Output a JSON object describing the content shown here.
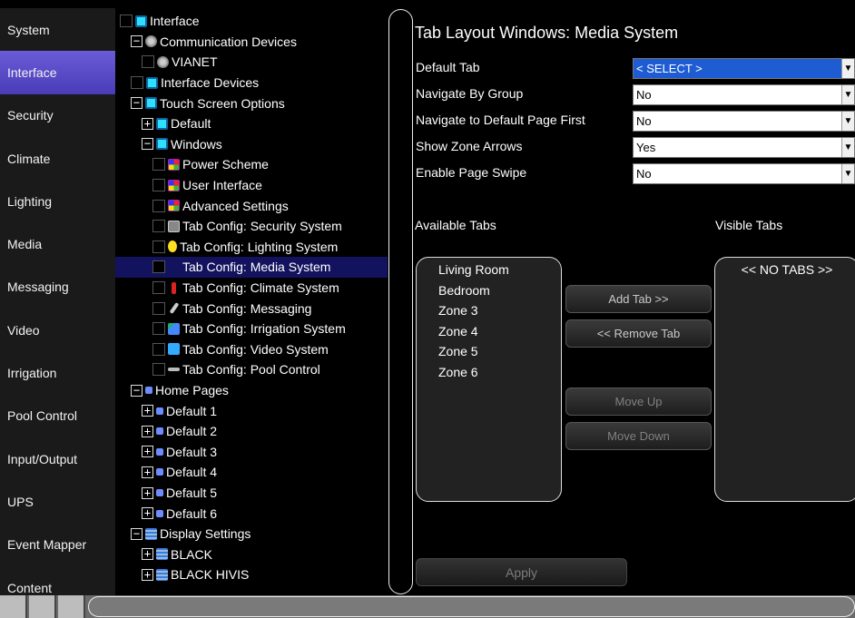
{
  "nav": {
    "items": [
      {
        "label": "System",
        "active": false
      },
      {
        "label": "Interface",
        "active": true
      },
      {
        "label": "Security",
        "active": false
      },
      {
        "label": "Climate",
        "active": false
      },
      {
        "label": "Lighting",
        "active": false
      },
      {
        "label": "Media",
        "active": false
      },
      {
        "label": "Messaging",
        "active": false
      },
      {
        "label": "Video",
        "active": false
      },
      {
        "label": "Irrigation",
        "active": false
      },
      {
        "label": "Pool Control",
        "active": false
      },
      {
        "label": "Input/Output",
        "active": false
      },
      {
        "label": "UPS",
        "active": false
      },
      {
        "label": "Event Mapper",
        "active": false
      },
      {
        "label": "Content",
        "active": false
      }
    ]
  },
  "tree": {
    "nodes": [
      {
        "label": "Interface",
        "level": 0,
        "expander": "checkbox",
        "icon": "interface-icon"
      },
      {
        "label": "Communication Devices",
        "level": 1,
        "expander": "minus",
        "icon": "comm-devices-icon"
      },
      {
        "label": "VIANET",
        "level": 2,
        "expander": "checkbox",
        "icon": "vianet-icon"
      },
      {
        "label": "Interface Devices",
        "level": 1,
        "expander": "checkbox",
        "icon": "interface-devices-icon"
      },
      {
        "label": "Touch Screen Options",
        "level": 1,
        "expander": "minus",
        "icon": "touch-screen-icon"
      },
      {
        "label": "Default",
        "level": 2,
        "expander": "plus",
        "icon": "default-icon"
      },
      {
        "label": "Windows",
        "level": 2,
        "expander": "minus",
        "icon": "windows-icon"
      },
      {
        "label": "Power Scheme",
        "level": 3,
        "expander": "checkbox",
        "icon": "power-scheme-icon"
      },
      {
        "label": "User Interface",
        "level": 3,
        "expander": "checkbox",
        "icon": "user-interface-icon"
      },
      {
        "label": "Advanced Settings",
        "level": 3,
        "expander": "checkbox",
        "icon": "advanced-settings-icon"
      },
      {
        "label": "Tab Config: Security System",
        "level": 3,
        "expander": "checkbox",
        "icon": "security-icon"
      },
      {
        "label": "Tab Config: Lighting System",
        "level": 3,
        "expander": "checkbox",
        "icon": "lightbulb-icon"
      },
      {
        "label": "Tab Config: Media System",
        "level": 3,
        "expander": "checkbox",
        "icon": "none",
        "selected": true
      },
      {
        "label": "Tab Config: Climate System",
        "level": 3,
        "expander": "checkbox",
        "icon": "thermometer-icon"
      },
      {
        "label": "Tab Config: Messaging",
        "level": 3,
        "expander": "checkbox",
        "icon": "pen-icon"
      },
      {
        "label": "Tab Config: Irrigation System",
        "level": 3,
        "expander": "checkbox",
        "icon": "irrigation-icon"
      },
      {
        "label": "Tab Config: Video System",
        "level": 3,
        "expander": "checkbox",
        "icon": "video-icon"
      },
      {
        "label": "Tab Config: Pool Control",
        "level": 3,
        "expander": "checkbox",
        "icon": "pool-icon"
      },
      {
        "label": "Home Pages",
        "level": 1,
        "expander": "minus",
        "icon": "home-pages-icon"
      },
      {
        "label": "Default 1",
        "level": 2,
        "expander": "plus",
        "icon": "page-icon"
      },
      {
        "label": "Default 2",
        "level": 2,
        "expander": "plus",
        "icon": "page-icon"
      },
      {
        "label": "Default 3",
        "level": 2,
        "expander": "plus",
        "icon": "page-icon"
      },
      {
        "label": "Default 4",
        "level": 2,
        "expander": "plus",
        "icon": "page-icon"
      },
      {
        "label": "Default 5",
        "level": 2,
        "expander": "plus",
        "icon": "page-icon"
      },
      {
        "label": "Default 6",
        "level": 2,
        "expander": "plus",
        "icon": "page-icon"
      },
      {
        "label": "Display Settings",
        "level": 1,
        "expander": "minus",
        "icon": "display-settings-icon"
      },
      {
        "label": "BLACK",
        "level": 2,
        "expander": "plus",
        "icon": "display-icon"
      },
      {
        "label": "BLACK HIVIS",
        "level": 2,
        "expander": "plus",
        "icon": "display-icon"
      }
    ]
  },
  "pane": {
    "title": "Tab Layout Windows: Media System",
    "fields": [
      {
        "label": "Default Tab",
        "value": "< SELECT >",
        "highlight": true
      },
      {
        "label": "Navigate By Group",
        "value": "No",
        "highlight": false
      },
      {
        "label": "Navigate to Default Page First",
        "value": "No",
        "highlight": false
      },
      {
        "label": "Show Zone Arrows",
        "value": "Yes",
        "highlight": false
      },
      {
        "label": "Enable Page Swipe",
        "value": "No",
        "highlight": false
      }
    ],
    "available_tabs_label": "Available Tabs",
    "visible_tabs_label": "Visible Tabs",
    "available_tabs": [
      "Living Room",
      "Bedroom",
      "Zone 3",
      "Zone 4",
      "Zone 5",
      "Zone 6"
    ],
    "visible_tabs": [
      "<< NO TABS >>"
    ],
    "buttons": {
      "add_tab": "Add Tab >>",
      "remove_tab": "<< Remove Tab",
      "move_up": "Move Up",
      "move_down": "Move Down",
      "apply": "Apply"
    }
  },
  "colors": {
    "nav_active": "#5a4cc8",
    "selection": "#12125e",
    "dropdown_highlight": "#1e5cd4"
  }
}
